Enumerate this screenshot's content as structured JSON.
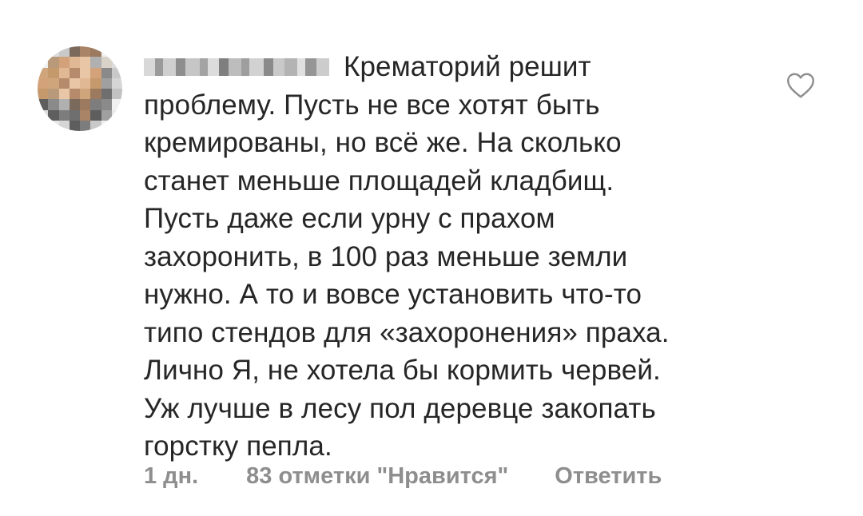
{
  "comment": {
    "text_lines": [
      "Крематорий решит",
      "проблему. Пусть не все хотят быть",
      "кремированы, но всё же. На сколько",
      "станет меньше площадей кладбищ.",
      "Пусть даже если урну с прахом",
      "захоронить, в 100 раз меньше земли",
      "нужно. А то и вовсе установить что-то",
      "типо стендов для «захоронения» праха.",
      "Лично Я, не хотела бы кормить червей.",
      "Уж лучше в лесу пол деревце закопать",
      "горстку пепла."
    ],
    "time": "1 дн.",
    "likes": "83 отметки \"Нравится\"",
    "reply_label": "Ответить",
    "like_icon": "heart-outline-icon"
  },
  "colors": {
    "text": "#262626",
    "meta": "#8e8e8e"
  }
}
